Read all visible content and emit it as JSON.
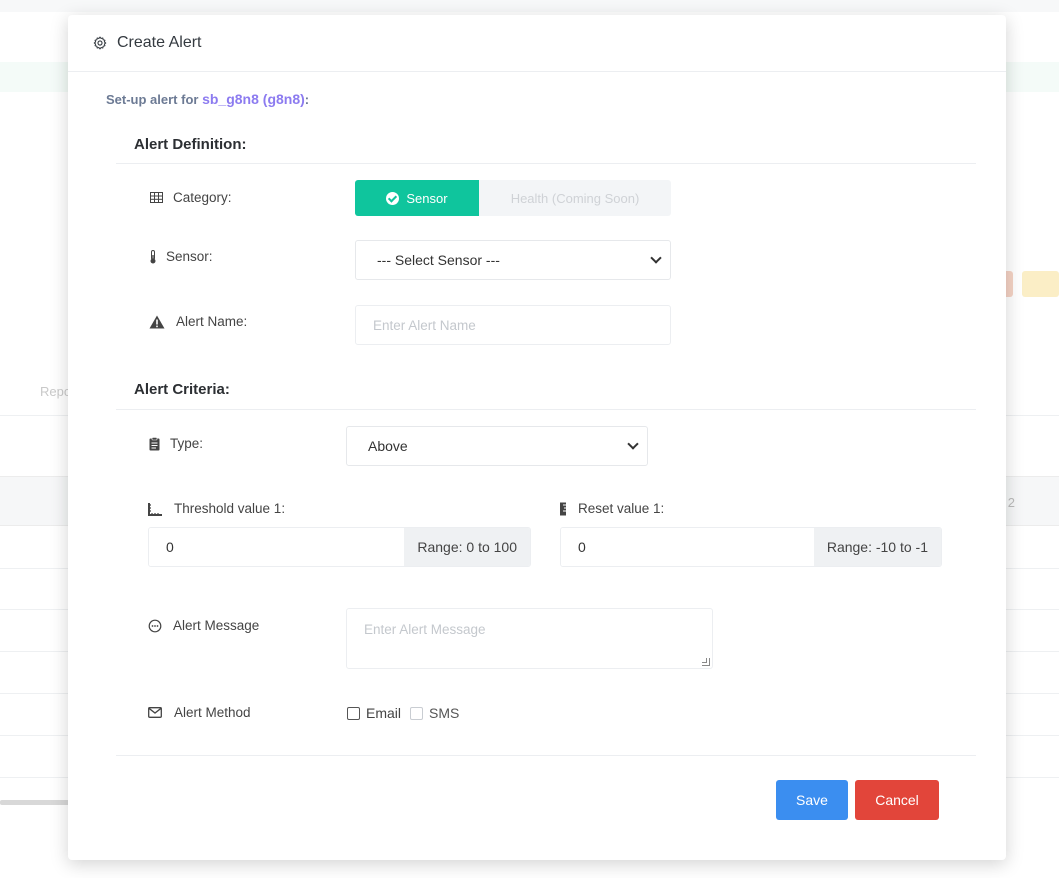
{
  "background": {
    "partial_text": "Repo",
    "partial_number": "2"
  },
  "modal": {
    "title": "Create Alert",
    "setup_prefix": "Set-up alert for",
    "device": "sb_g8n8 (g8n8)",
    "setup_suffix": ":"
  },
  "definition": {
    "title": "Alert Definition:",
    "category_label": "Category:",
    "category_options": [
      "Sensor",
      "Health (Coming Soon)"
    ],
    "category_selected": "Sensor",
    "sensor_label": "Sensor:",
    "sensor_value": "--- Select Sensor ---",
    "name_label": "Alert Name:",
    "name_placeholder": "Enter Alert Name"
  },
  "criteria": {
    "title": "Alert Criteria:",
    "type_label": "Type:",
    "type_value": "Above",
    "threshold_label": "Threshold value 1:",
    "threshold_value": "0",
    "threshold_range": "Range: 0 to 100",
    "reset_label": "Reset value 1:",
    "reset_value": "0",
    "reset_range": "Range: -10 to -1",
    "message_label": "Alert Message",
    "message_placeholder": "Enter Alert Message",
    "method_label": "Alert Method",
    "methods": [
      {
        "label": "Email",
        "checked": false,
        "enabled": true
      },
      {
        "label": "SMS",
        "checked": false,
        "enabled": false
      }
    ]
  },
  "footer": {
    "save_label": "Save",
    "cancel_label": "Cancel"
  },
  "colors": {
    "accent_green": "#0fc59d",
    "save_blue": "#3b8ef0",
    "cancel_red": "#e2453a",
    "device_purple": "#8c7bf0"
  }
}
